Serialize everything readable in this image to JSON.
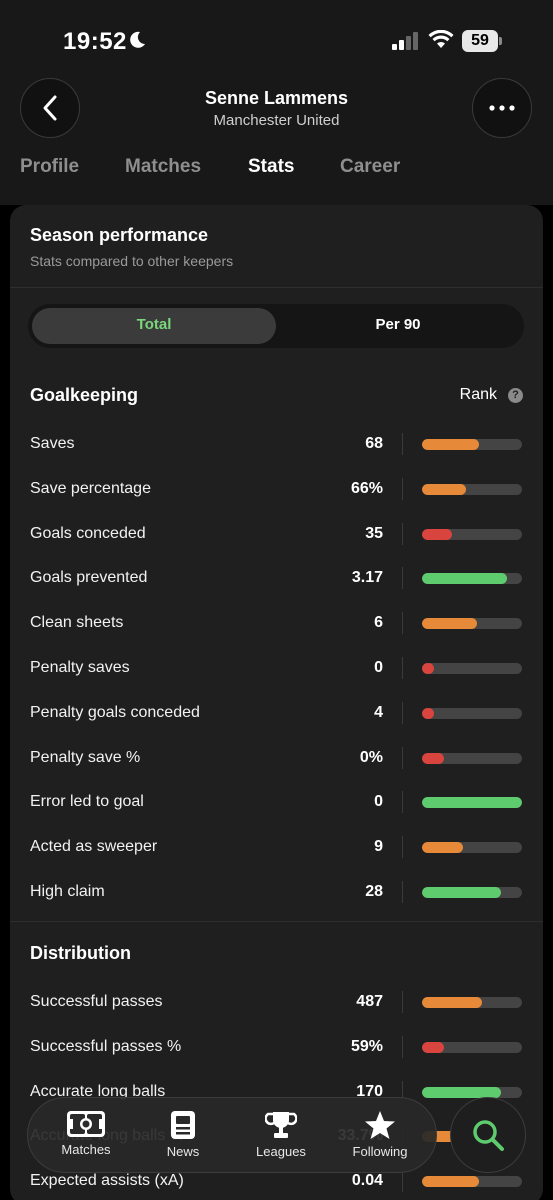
{
  "status_bar": {
    "time": "19:52",
    "battery": "59"
  },
  "header": {
    "player_name": "Senne Lammens",
    "team_name": "Manchester United",
    "back_icon": "chevron-left-icon",
    "more_icon": "more-horizontal-icon"
  },
  "tabs": [
    {
      "label": "Profile",
      "active": false
    },
    {
      "label": "Matches",
      "active": false
    },
    {
      "label": "Stats",
      "active": true
    },
    {
      "label": "Career",
      "active": false
    }
  ],
  "card": {
    "title": "Season performance",
    "subtitle": "Stats compared to other keepers",
    "toggle": {
      "total": "Total",
      "per90": "Per 90",
      "selected": "Total"
    }
  },
  "colors": {
    "green": "#5ecb6e",
    "orange": "#e68a3a",
    "red": "#d9443e",
    "accent": "#7ad67a"
  },
  "goalkeeping": {
    "title": "Goalkeeping",
    "rank_label": "Rank",
    "rank_help": "?",
    "rows": [
      {
        "label": "Saves",
        "value": "68",
        "rank": 0.57,
        "color": "orange"
      },
      {
        "label": "Save percentage",
        "value": "66%",
        "rank": 0.44,
        "color": "orange"
      },
      {
        "label": "Goals conceded",
        "value": "35",
        "rank": 0.3,
        "color": "red"
      },
      {
        "label": "Goals prevented",
        "value": "3.17",
        "rank": 0.85,
        "color": "green"
      },
      {
        "label": "Clean sheets",
        "value": "6",
        "rank": 0.55,
        "color": "orange"
      },
      {
        "label": "Penalty saves",
        "value": "0",
        "rank": 0.12,
        "color": "red"
      },
      {
        "label": "Penalty goals conceded",
        "value": "4",
        "rank": 0.12,
        "color": "red"
      },
      {
        "label": "Penalty save %",
        "value": "0%",
        "rank": 0.22,
        "color": "red"
      },
      {
        "label": "Error led to goal",
        "value": "0",
        "rank": 1.0,
        "color": "green"
      },
      {
        "label": "Acted as sweeper",
        "value": "9",
        "rank": 0.41,
        "color": "orange"
      },
      {
        "label": "High claim",
        "value": "28",
        "rank": 0.79,
        "color": "green"
      }
    ]
  },
  "distribution": {
    "title": "Distribution",
    "rows": [
      {
        "label": "Successful passes",
        "value": "487",
        "rank": 0.6,
        "color": "orange"
      },
      {
        "label": "Successful passes %",
        "value": "59%",
        "rank": 0.22,
        "color": "red"
      },
      {
        "label": "Accurate long balls",
        "value": "170",
        "rank": 0.79,
        "color": "green"
      },
      {
        "label": "Accurate long balls %",
        "value": "33.7%",
        "rank": 0.4,
        "color": "orange"
      },
      {
        "label": "Expected assists (xA)",
        "value": "0.04",
        "rank": 0.57,
        "color": "orange"
      }
    ]
  },
  "bottom_nav": [
    {
      "label": "Matches",
      "icon": "pitch-icon"
    },
    {
      "label": "News",
      "icon": "news-icon"
    },
    {
      "label": "Leagues",
      "icon": "trophy-icon"
    },
    {
      "label": "Following",
      "icon": "star-icon"
    }
  ],
  "search_fab": {
    "icon": "search-icon"
  }
}
